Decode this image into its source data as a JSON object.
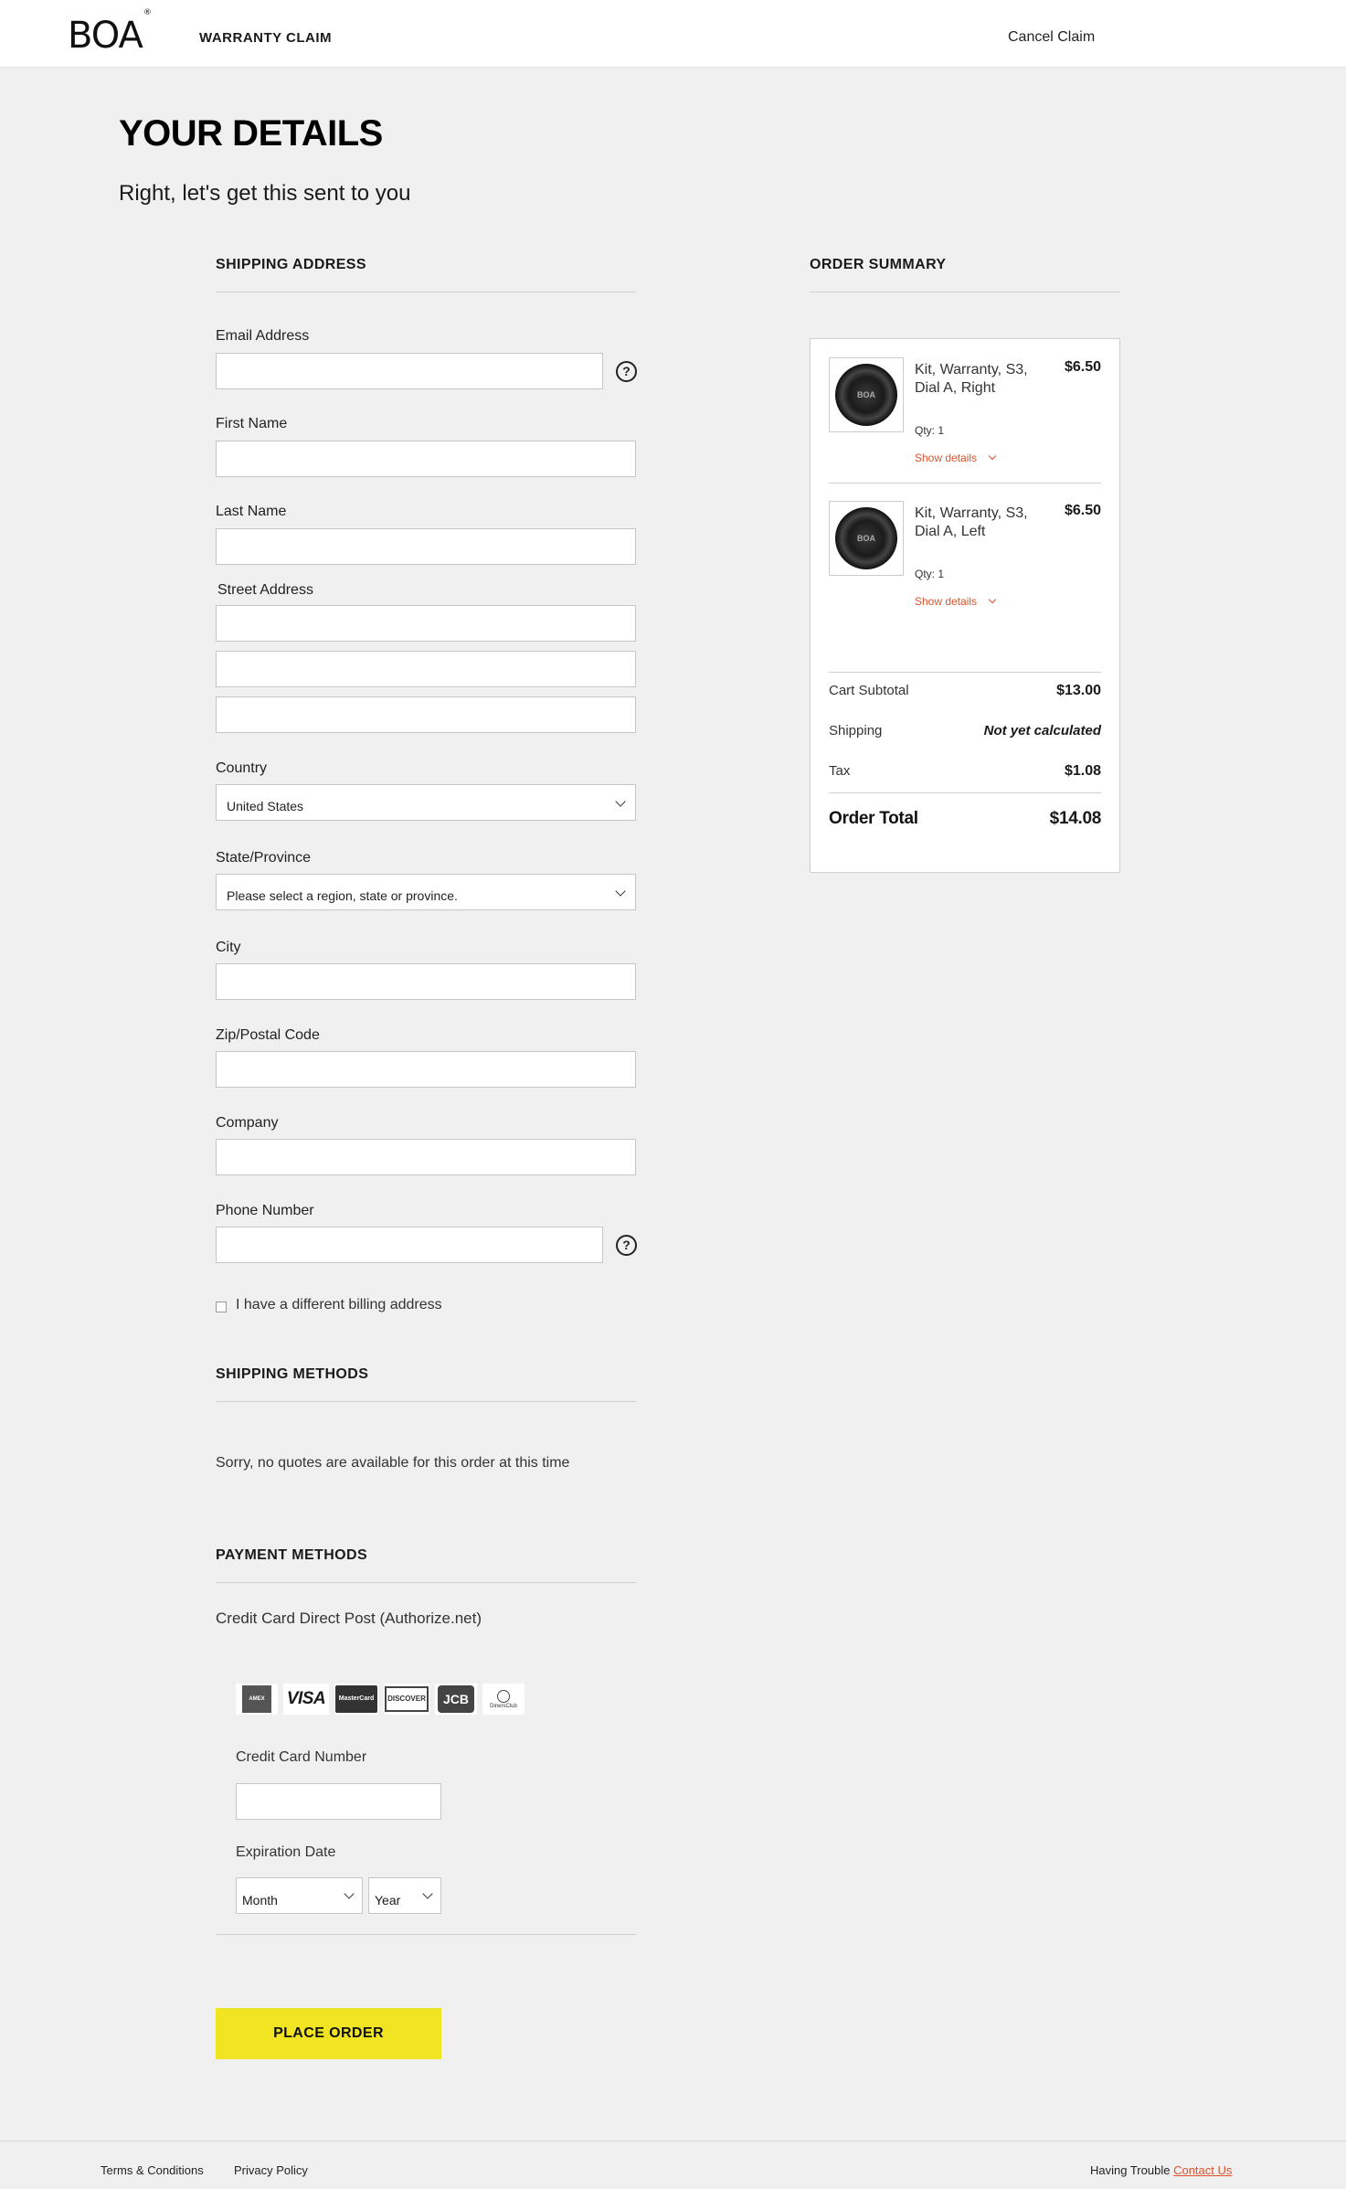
{
  "header": {
    "logo_text": "BOA",
    "logo_mark": "®",
    "title": "WARRANTY CLAIM",
    "cancel_label": "Cancel Claim"
  },
  "page": {
    "title": "YOUR DETAILS",
    "subtitle": "Right, let's get this sent to you"
  },
  "shipping_address": {
    "heading": "SHIPPING ADDRESS",
    "email_label": "Email Address",
    "email_value": "",
    "first_name_label": "First Name",
    "last_name_label": "Last Name",
    "street_label": "Street Address",
    "country_label": "Country",
    "country_value": "United States",
    "state_label": "State/Province",
    "state_value": "Please select a region, state or province.",
    "city_label": "City",
    "zip_label": "Zip/Postal Code",
    "company_label": "Company",
    "phone_label": "Phone Number",
    "help_glyph": "?",
    "billing_checkbox_label": "I have a different billing address",
    "billing_checkbox_checked": false
  },
  "shipping_methods": {
    "heading": "SHIPPING METHODS",
    "message": "Sorry, no quotes are available for this order at this time"
  },
  "payment_methods": {
    "heading": "PAYMENT METHODS",
    "method_name": "Credit Card Direct Post (Authorize.net)",
    "card_icons": [
      "amex-icon",
      "visa-icon",
      "mastercard-icon",
      "discover-icon",
      "jcb-icon",
      "diners-club-icon"
    ],
    "card_label": "Credit Card Number",
    "expiration_label": "Expiration Date",
    "month_value": "Month",
    "year_value": "Year"
  },
  "place_order_label": "PLACE ORDER",
  "order_summary": {
    "heading": "ORDER SUMMARY",
    "items": [
      {
        "name": "Kit, Warranty, S3, Dial A, Right",
        "price": "$6.50",
        "qty": "Qty: 1",
        "details_label": "Show details",
        "thumb_text": "BOA"
      },
      {
        "name": "Kit, Warranty, S3, Dial A, Left",
        "price": "$6.50",
        "qty": "Qty: 1",
        "details_label": "Show details",
        "thumb_text": "BOA"
      }
    ],
    "subtotal_label": "Cart Subtotal",
    "subtotal_value": "$13.00",
    "shipping_label": "Shipping",
    "shipping_value": "Not yet calculated",
    "tax_label": "Tax",
    "tax_value": "$1.08",
    "total_label": "Order Total",
    "total_value": "$14.08"
  },
  "footer": {
    "terms_label": "Terms & Conditions",
    "privacy_label": "Privacy Policy",
    "trouble_text": "Having Trouble",
    "contact_label": "Contact Us"
  },
  "colors": {
    "background": "#f0f0f0",
    "accent_button": "#f1e523",
    "link_accent": "#d9532c"
  }
}
